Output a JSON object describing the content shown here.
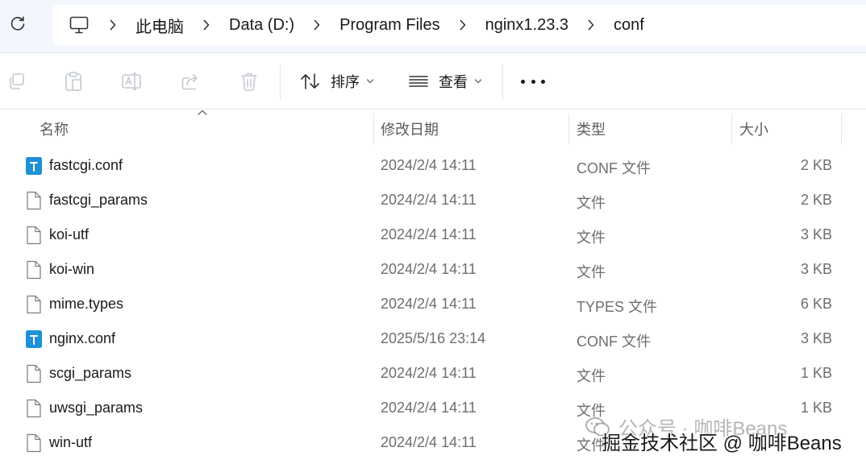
{
  "address_bar": {
    "crumbs": [
      "此电脑",
      "Data (D:)",
      "Program Files",
      "nginx1.23.3",
      "conf"
    ]
  },
  "command_bar": {
    "sort_label": "排序",
    "view_label": "查看"
  },
  "columns": {
    "name": "名称",
    "modified": "修改日期",
    "type": "类型",
    "size": "大小"
  },
  "files": [
    {
      "name": "fastcgi.conf",
      "modified": "2024/2/4 14:11",
      "type": "CONF 文件",
      "size": "2 KB",
      "icon": "text-file-icon"
    },
    {
      "name": "fastcgi_params",
      "modified": "2024/2/4 14:11",
      "type": "文件",
      "size": "2 KB",
      "icon": "blank-file-icon"
    },
    {
      "name": "koi-utf",
      "modified": "2024/2/4 14:11",
      "type": "文件",
      "size": "3 KB",
      "icon": "blank-file-icon"
    },
    {
      "name": "koi-win",
      "modified": "2024/2/4 14:11",
      "type": "文件",
      "size": "3 KB",
      "icon": "blank-file-icon"
    },
    {
      "name": "mime.types",
      "modified": "2024/2/4 14:11",
      "type": "TYPES 文件",
      "size": "6 KB",
      "icon": "blank-file-icon"
    },
    {
      "name": "nginx.conf",
      "modified": "2025/5/16 23:14",
      "type": "CONF 文件",
      "size": "3 KB",
      "icon": "text-file-icon"
    },
    {
      "name": "scgi_params",
      "modified": "2024/2/4 14:11",
      "type": "文件",
      "size": "1 KB",
      "icon": "blank-file-icon"
    },
    {
      "name": "uwsgi_params",
      "modified": "2024/2/4 14:11",
      "type": "文件",
      "size": "1 KB",
      "icon": "blank-file-icon"
    },
    {
      "name": "win-utf",
      "modified": "2024/2/4 14:11",
      "type": "文件",
      "size": "",
      "icon": "blank-file-icon"
    }
  ],
  "watermark": {
    "line1": "公众号 · 咖啡Beans",
    "line2": "掘金技术社区 @ 咖啡Beans"
  },
  "colors": {
    "accent": "#1e90d6",
    "address_strip": "#f3f6fc",
    "secondary_text": "#6e6e6e"
  }
}
